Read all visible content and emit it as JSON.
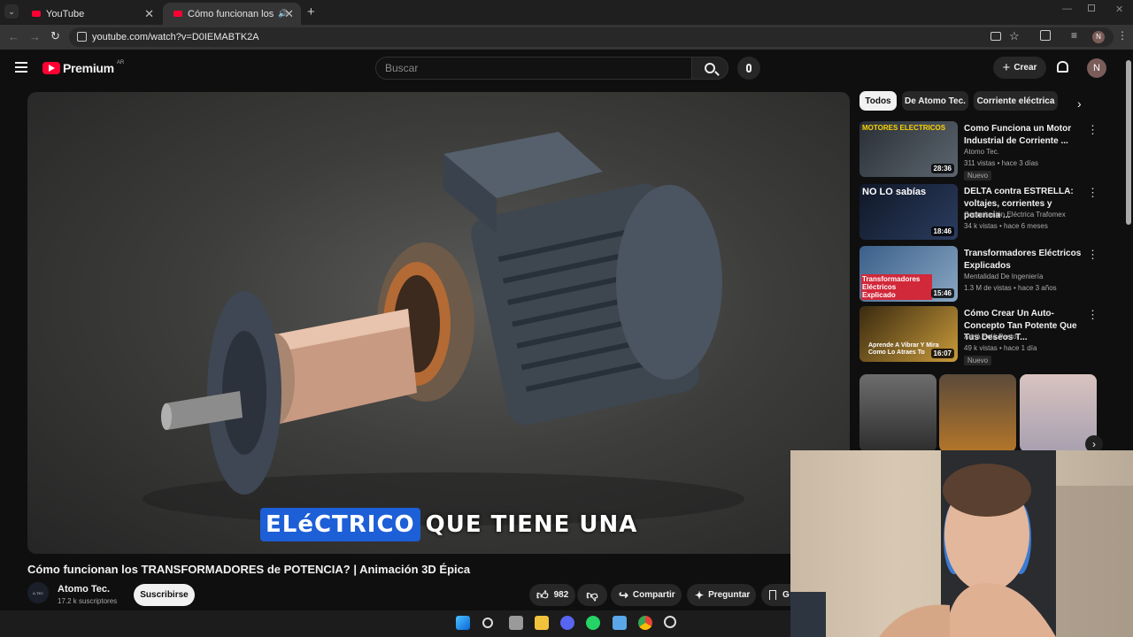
{
  "browser": {
    "tabs": [
      {
        "title": "YouTube"
      },
      {
        "title": "Cómo funcionan los TRANS"
      }
    ],
    "url": "youtube.com/watch?v=D0IEMABTK2A",
    "profile_initial": "N"
  },
  "header": {
    "brand": "Premium",
    "region": "AR",
    "search_placeholder": "Buscar",
    "create_label": "Crear",
    "avatar_initial": "N"
  },
  "video": {
    "caption_highlight": "ELéCTRICO",
    "caption_rest": "QUE TIENE UNA",
    "title": "Cómo funcionan los TRANSFORMADORES de POTENCIA? | Animación 3D Épica",
    "channel": "Atomo Tec.",
    "channel_logo_text": "A-TEC",
    "subscribers": "17.2 k suscriptores",
    "subscribe_label": "Suscribirse",
    "likes": "982",
    "share_label": "Compartir",
    "ask_label": "Preguntar",
    "save_label_partial": "G"
  },
  "sidebar": {
    "chips": [
      "Todos",
      "De Atomo Tec.",
      "Corriente eléctrica"
    ],
    "recommendations": [
      {
        "title": "Como Funciona un Motor Industrial de Corriente ...",
        "channel": "Atomo Tec.",
        "meta": "311 vistas • hace 3 días",
        "badge": "Nuevo",
        "duration": "28:36",
        "thumb_text": "MOTORES ELECTRICOS"
      },
      {
        "title": "DELTA contra ESTRELLA: voltajes, corrientes y potencia ...",
        "channel": "Capacitación Eléctrica Trafomex",
        "meta": "34 k vistas • hace 6 meses",
        "badge": "",
        "duration": "18:46",
        "thumb_text": "NO LO sabías"
      },
      {
        "title": "Transformadores Eléctricos Explicados",
        "channel": "Mentalidad De Ingeniería",
        "meta": "1.3 M de vistas • hace 3 años",
        "badge": "",
        "duration": "15:46",
        "thumb_text": "Transformadores Eléctricos Explicado"
      },
      {
        "title": "Cómo Crear Un Auto-Concepto Tan Potente Que Tus Deseos T...",
        "channel": "Adrià Solà Pastor",
        "meta": "49 k vistas • hace 1 día",
        "badge": "Nuevo",
        "duration": "16:07",
        "thumb_text": "Aprende A Vibrar Y Mira Como Lo Atraes To"
      }
    ]
  },
  "colors": {
    "yt_red": "#ff0033",
    "bg": "#0f0f0f",
    "chip_bg": "#272727",
    "caption_box": "#1d5fd6"
  }
}
